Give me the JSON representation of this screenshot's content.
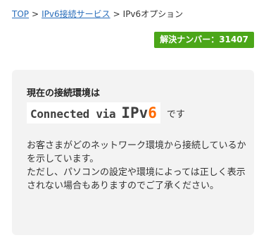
{
  "breadcrumb": {
    "items": [
      {
        "label": "TOP"
      },
      {
        "label": "IPv6接続サービス"
      }
    ],
    "separator": ">",
    "current": "IPv6オプション"
  },
  "badge": {
    "text": "解決ナンバー：31407",
    "color": "#4ba619"
  },
  "card": {
    "title": "現在の接続環境は",
    "connection": {
      "text": "Connected via",
      "ipv": "IPv",
      "six": "6",
      "suffix": "です",
      "accent_color": "#ff6a00"
    },
    "paragraphs": [
      "お客さまがどのネットワーク環境から接続しているかを示しています。",
      "ただし、パソコンの設定や環境によっては正しく表示されない場合もありますのでご了承ください。"
    ]
  }
}
